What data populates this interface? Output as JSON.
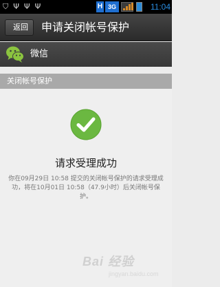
{
  "status_bar": {
    "network_h": "H",
    "network_3g": "3G",
    "time": "11:04",
    "icons": [
      "shield-icon",
      "usb-icon",
      "usb-icon",
      "usb-icon"
    ],
    "signal_color": "#d68a28",
    "battery_color": "#2c8bd7"
  },
  "titlebar": {
    "back_label": "返回",
    "title": "申请关闭帐号保护"
  },
  "app": {
    "name": "微信",
    "icon": "wechat-icon",
    "icon_color": "#8bc43f"
  },
  "section": {
    "header": "关闭帐号保护"
  },
  "result": {
    "icon": "check-circle-icon",
    "icon_color": "#6bb841",
    "title": "请求受理成功",
    "description": "你在09月29日 10:58 提交的关闭帐号保护的请求受理成功，将在10月01日 10:58（47.9小时）后关闭帐号保护。"
  },
  "watermark": {
    "line1": "Bai 经验",
    "line2": "jingyan.baidu.com"
  }
}
